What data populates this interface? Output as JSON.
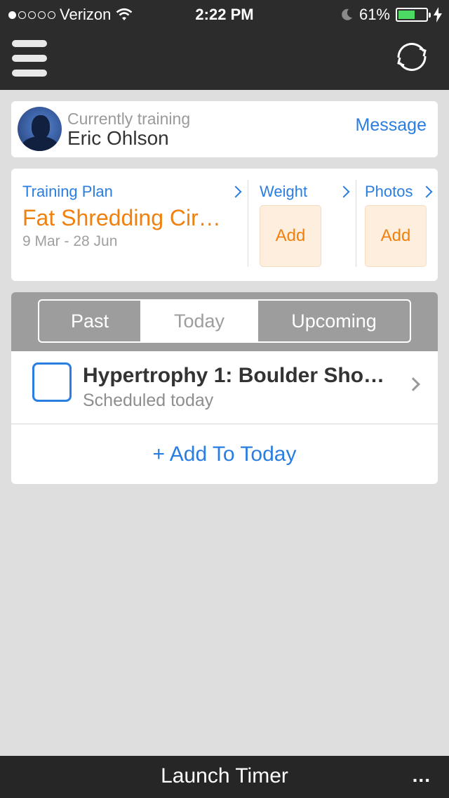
{
  "status_bar": {
    "carrier": "Verizon",
    "signal_dots_filled": 1,
    "signal_dots_total": 5,
    "time": "2:22 PM",
    "battery": "61%",
    "battery_level": 0.61,
    "icons": [
      "wifi-icon",
      "moon-icon",
      "battery-icon",
      "charging-bolt-icon"
    ]
  },
  "nav": {
    "menu_icon": "hamburger-menu-icon",
    "sync_icon": "sync-icon"
  },
  "trainer": {
    "subtitle": "Currently training",
    "name": "Eric Ohlson",
    "message_label": "Message"
  },
  "plan": {
    "training_plan_label": "Training Plan",
    "plan_title": "Fat Shredding Cir…",
    "dates": "9 Mar - 28 Jun",
    "weight_label": "Weight",
    "weight_add": "Add",
    "photos_label": "Photos",
    "photos_add": "Add"
  },
  "tabs": {
    "past": "Past",
    "today": "Today",
    "upcoming": "Upcoming",
    "selected": "Today"
  },
  "workout": {
    "title": "Hypertrophy 1: Boulder Sho…",
    "subtitle": "Scheduled today",
    "checked": false
  },
  "add_to_today": "+ Add To Today",
  "bottom_bar": {
    "launch_timer": "Launch Timer",
    "more": "..."
  },
  "colors": {
    "accent_blue": "#2a7de1",
    "accent_orange": "#f0810f",
    "nav_bg": "#2c2c2c",
    "page_bg": "#dedede"
  }
}
